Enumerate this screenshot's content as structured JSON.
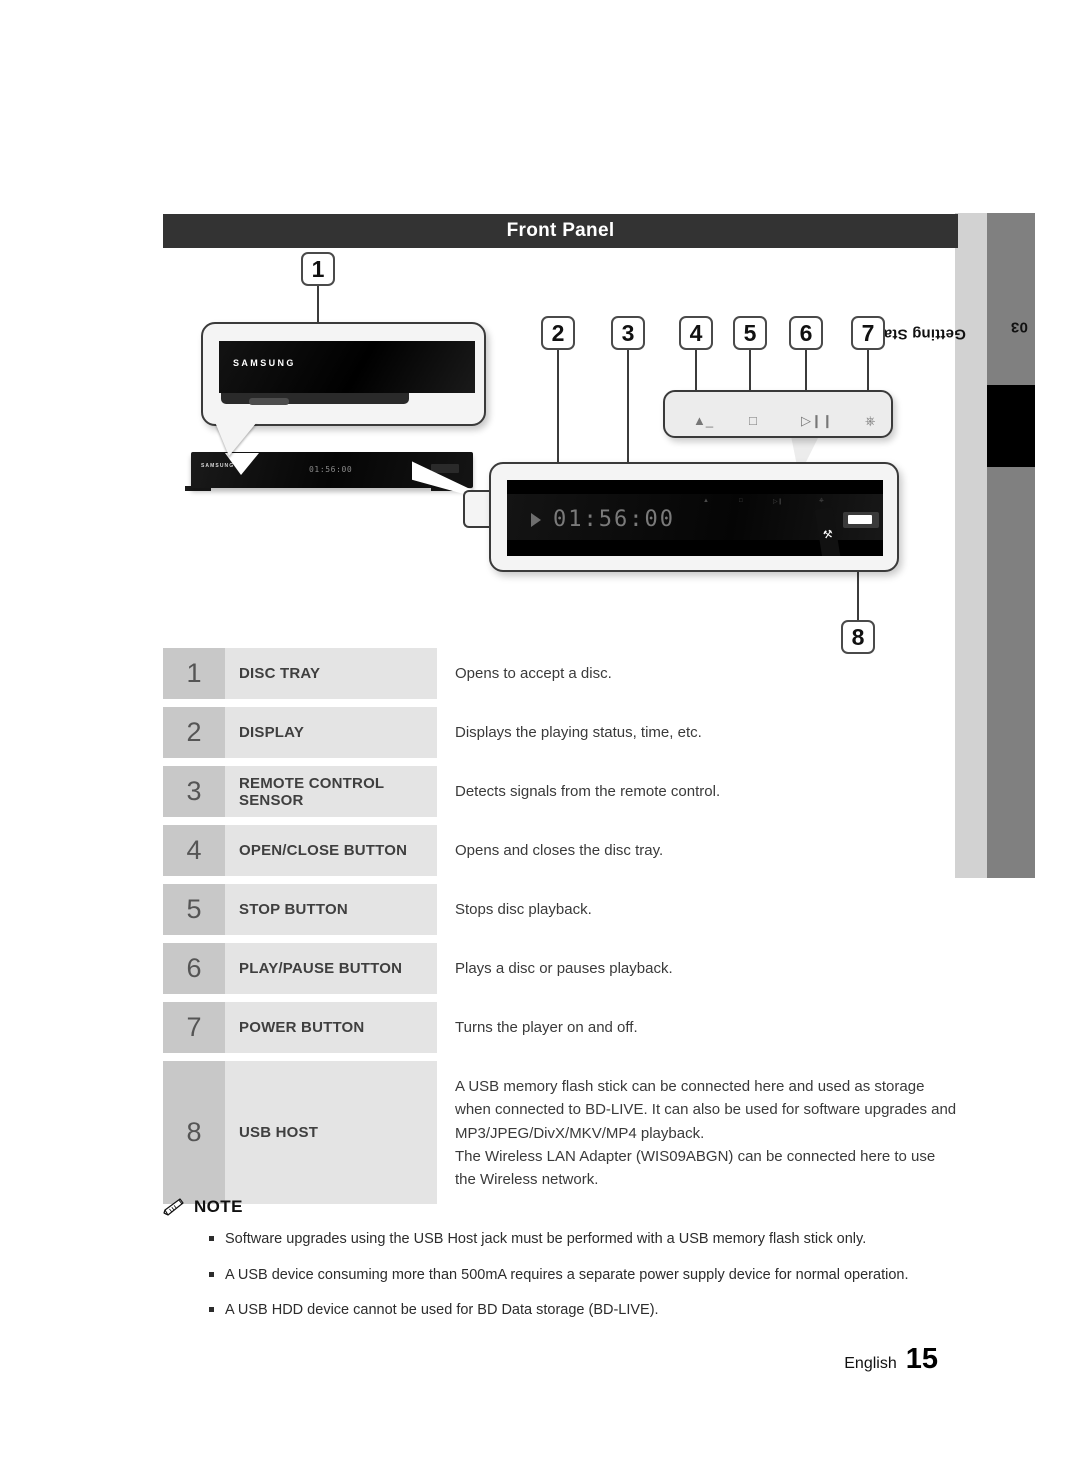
{
  "header": {
    "title": "Front Panel"
  },
  "side_tab": {
    "chapter": "03",
    "section": "Getting Started"
  },
  "diagram": {
    "brand": "SAMSUNG",
    "brand_small": "SAMSUNG",
    "display_time": "01:56:00",
    "display_time_small": "01:56:00",
    "callouts": [
      "1",
      "2",
      "3",
      "4",
      "5",
      "6",
      "7",
      "8"
    ],
    "button_icons": [
      "eject-icon",
      "stop-icon",
      "play-pause-icon",
      "power-icon"
    ],
    "usb_icon": "usb-trident-icon"
  },
  "spec_table": {
    "rows": [
      {
        "num": "1",
        "label": "DISC TRAY",
        "desc": "Opens to accept a disc."
      },
      {
        "num": "2",
        "label": "DISPLAY",
        "desc": "Displays the playing status, time, etc."
      },
      {
        "num": "3",
        "label": "REMOTE CONTROL SENSOR",
        "desc": "Detects signals from the remote control."
      },
      {
        "num": "4",
        "label": "OPEN/CLOSE BUTTON",
        "desc": "Opens and closes the disc tray."
      },
      {
        "num": "5",
        "label": "STOP BUTTON",
        "desc": "Stops disc playback."
      },
      {
        "num": "6",
        "label": "PLAY/PAUSE BUTTON",
        "desc": "Plays a disc or pauses playback."
      },
      {
        "num": "7",
        "label": "POWER BUTTON",
        "desc": "Turns the player on and off."
      }
    ],
    "usb_row": {
      "num": "8",
      "label": "USB HOST",
      "desc_p1": "A USB memory flash stick can be connected here and used as storage when connected to BD-LIVE. It can also be used for software upgrades and MP3/JPEG/DivX/MKV/MP4 playback.",
      "desc_p2": "The Wireless LAN Adapter (WIS09ABGN) can be connected here to use the Wireless network."
    }
  },
  "note": {
    "icon": "pencil-icon",
    "title": "NOTE",
    "items": [
      "Software upgrades using the USB Host jack must be performed with a USB memory flash stick only.",
      "A USB device consuming more than 500mA requires a separate power supply device for normal operation.",
      "A USB HDD device cannot be used for BD Data storage (BD-LIVE)."
    ]
  },
  "footer": {
    "language": "English",
    "page": "15"
  }
}
